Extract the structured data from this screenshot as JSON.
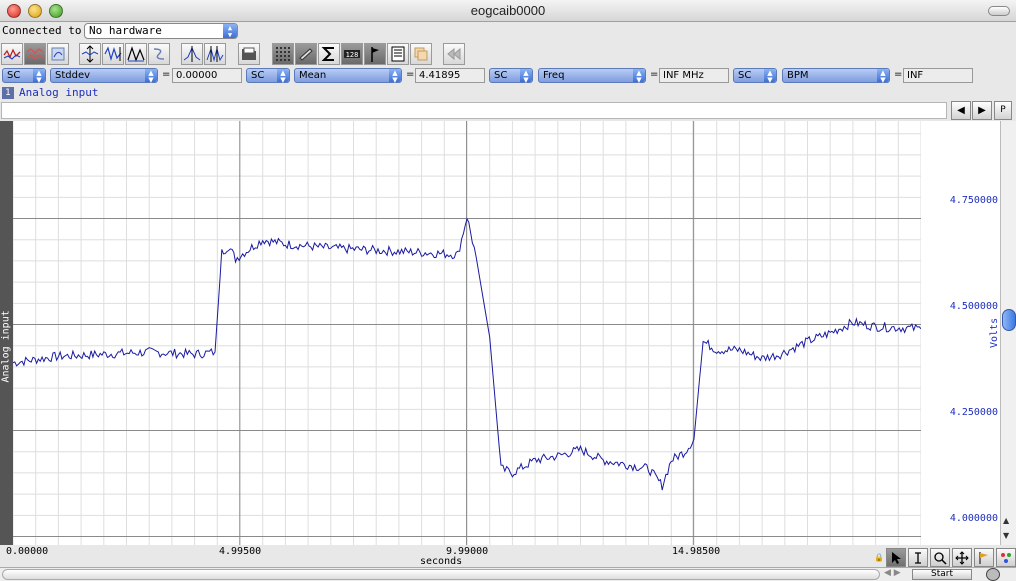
{
  "window": {
    "title": "eogcaib0000"
  },
  "connection": {
    "label": "Connected to:",
    "value": "No hardware"
  },
  "toolbar": {
    "icons": [
      "waveform-view-icon",
      "overlay-view-icon",
      "xy-view-icon",
      "zoom-fit-icon",
      "zoom-vertical-icon",
      "autoscale-icon",
      "offset-icon",
      "marker-icon",
      "peak-marker-icon",
      "open-folder-icon",
      "grid-icon",
      "pencil-icon",
      "sigma-icon",
      "numeric-display-icon",
      "flag-icon",
      "notebook-icon",
      "copy-icon",
      "rewind-icon"
    ]
  },
  "measurements": [
    {
      "channel": "SC",
      "function": "Stddev",
      "equals": "=",
      "value": "0.00000"
    },
    {
      "channel": "SC",
      "function": "Mean",
      "equals": "=",
      "value": "4.41895"
    },
    {
      "channel": "SC",
      "function": "Freq",
      "equals": "=",
      "value": "INF MHz"
    },
    {
      "channel": "SC",
      "function": "BPM",
      "equals": "=",
      "value": "INF"
    }
  ],
  "channel": {
    "number": "1",
    "name": "Analog input"
  },
  "nav": {
    "prev": "◀",
    "next": "▶",
    "page": "P"
  },
  "plot": {
    "left_label": "Analog input",
    "y_unit": "Volts",
    "y_ticks": [
      "4.750000",
      "4.500000",
      "4.250000",
      "4.000000"
    ],
    "x_ticks": [
      "0.00000",
      "4.99500",
      "9.99000",
      "14.98500"
    ],
    "x_unit": "seconds",
    "line_color": "#1a1aa0"
  },
  "chart_data": {
    "type": "line",
    "xlabel": "seconds",
    "ylabel": "Volts",
    "xlim": [
      0,
      20
    ],
    "ylim": [
      3.98,
      4.98
    ],
    "series": [
      {
        "x": [
          0,
          1,
          2,
          3,
          4,
          4.45,
          4.6,
          4.75,
          4.9,
          5.5,
          6,
          7,
          8,
          9,
          9.8,
          10.0,
          10.2,
          10.5,
          10.75,
          11,
          11.5,
          12,
          12.5,
          13,
          13.5,
          14,
          14.3,
          14.5,
          14.8,
          15.0,
          15.2,
          15.5,
          16,
          16.5,
          16.9,
          17.5,
          18,
          18.5,
          19,
          20
        ],
        "y": [
          4.41,
          4.425,
          4.43,
          4.435,
          4.43,
          4.435,
          4.67,
          4.685,
          4.655,
          4.7,
          4.69,
          4.68,
          4.675,
          4.67,
          4.665,
          4.755,
          4.66,
          4.47,
          4.16,
          4.15,
          4.18,
          4.19,
          4.205,
          4.18,
          4.17,
          4.16,
          4.12,
          4.18,
          4.2,
          4.23,
          4.46,
          4.44,
          4.44,
          4.42,
          4.43,
          4.46,
          4.48,
          4.505,
          4.495,
          4.49
        ]
      }
    ],
    "grid": true
  }
}
